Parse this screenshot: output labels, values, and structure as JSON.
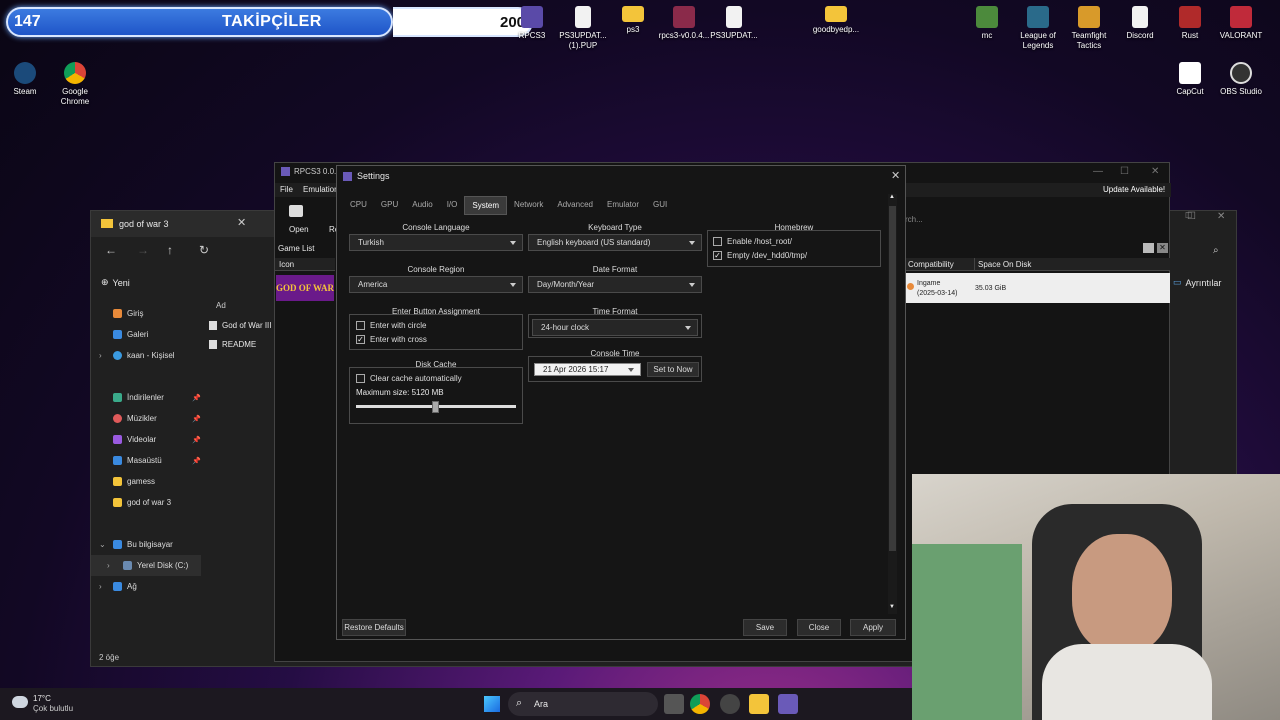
{
  "overlay": {
    "left_count": "147",
    "label": "TAKİPÇİLER",
    "right_count": "200"
  },
  "desktop": {
    "top": [
      {
        "label": "RPCS3"
      },
      {
        "label": "PS3UPDAT... (1).PUP"
      },
      {
        "label": "ps3"
      },
      {
        "label": "rpcs3-v0.0.4..."
      },
      {
        "label": "PS3UPDAT..."
      },
      {
        "label": "goodbyedp..."
      },
      {
        "label": "mc"
      },
      {
        "label": "League of Legends"
      },
      {
        "label": "Teamfight Tactics"
      },
      {
        "label": "Discord"
      },
      {
        "label": "Rust"
      },
      {
        "label": "VALORANT"
      }
    ],
    "left": [
      {
        "label": "Steam"
      },
      {
        "label": "Google Chrome"
      }
    ],
    "right": [
      {
        "label": "CapCut"
      },
      {
        "label": "OBS Studio"
      }
    ]
  },
  "explorer": {
    "tab_title": "god of war 3",
    "new_label": "Yeni",
    "col_name": "Ad",
    "details_label": "Ayrıntılar",
    "nav": [
      {
        "label": "Giriş"
      },
      {
        "label": "Galeri"
      },
      {
        "label": "kaan - Kişisel"
      },
      {
        "label": "İndirilenler"
      },
      {
        "label": "Müzikler"
      },
      {
        "label": "Videolar"
      },
      {
        "label": "Masaüstü"
      },
      {
        "label": "gamess"
      },
      {
        "label": "god of war 3"
      },
      {
        "label": "Bu bilgisayar"
      },
      {
        "label": "Yerel Disk (C:)"
      },
      {
        "label": "Ağ"
      }
    ],
    "files": [
      {
        "label": "God of War III ("
      },
      {
        "label": "README"
      }
    ],
    "status": "2 öğe"
  },
  "rpcs3": {
    "title": "RPCS3 0.0.4",
    "menu": [
      "File",
      "Emulation"
    ],
    "toolbar": {
      "open": "Open",
      "re": "Re"
    },
    "game_list": "Game List",
    "icon_col": "Icon",
    "update": "Update Available!",
    "search": "rch...",
    "col_compat": "Compatibility",
    "col_space": "Space On Disk",
    "row": {
      "compat": "Ingame",
      "compat_date": "(2025-03-14)",
      "space": "35.03 GiB"
    }
  },
  "settings": {
    "title": "Settings",
    "tabs": [
      "CPU",
      "GPU",
      "Audio",
      "I/O",
      "System",
      "Network",
      "Advanced",
      "Emulator",
      "GUI"
    ],
    "active_tab": "System",
    "console_language": {
      "label": "Console Language",
      "value": "Turkish"
    },
    "keyboard_type": {
      "label": "Keyboard Type",
      "value": "English keyboard (US standard)"
    },
    "homebrew": {
      "label": "Homebrew",
      "opt1": "Enable /host_root/",
      "opt1_checked": false,
      "opt2": "Empty /dev_hdd0/tmp/",
      "opt2_checked": true
    },
    "console_region": {
      "label": "Console Region",
      "value": "America"
    },
    "date_format": {
      "label": "Date Format",
      "value": "Day/Month/Year"
    },
    "enter_button": {
      "label": "Enter Button Assignment",
      "opt1": "Enter with circle",
      "opt1_checked": false,
      "opt2": "Enter with cross",
      "opt2_checked": true
    },
    "time_format": {
      "label": "Time Format",
      "value": "24-hour clock"
    },
    "console_time": {
      "label": "Console Time",
      "value": "21 Apr 2026 15:17",
      "button": "Set to Now"
    },
    "disk_cache": {
      "label": "Disk Cache",
      "clear": "Clear cache automatically",
      "clear_checked": false,
      "max_size": "Maximum size: 5120 MB",
      "fraction": 0.5
    },
    "buttons": {
      "restore": "Restore Defaults",
      "save": "Save",
      "close": "Close",
      "apply": "Apply"
    }
  },
  "taskbar": {
    "temp": "17°C",
    "weather": "Çok bulutlu",
    "search": "Ara"
  }
}
